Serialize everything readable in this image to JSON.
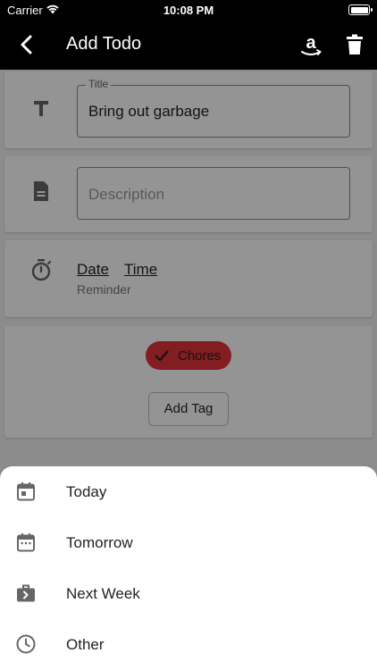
{
  "status_bar": {
    "carrier": "Carrier",
    "time": "10:08 PM"
  },
  "app_bar": {
    "title": "Add Todo"
  },
  "form": {
    "title_field": {
      "label": "Title",
      "value": "Bring out garbage"
    },
    "description_field": {
      "placeholder": "Description"
    },
    "reminder": {
      "date_label": "Date",
      "time_label": "Time",
      "subtitle": "Reminder"
    },
    "tags": {
      "selected": [
        "Chores"
      ],
      "chip_color": "#e0333c",
      "add_tag_label": "Add Tag"
    }
  },
  "bottom_sheet": {
    "items": [
      {
        "label": "Today",
        "icon": "calendar-today-icon"
      },
      {
        "label": "Tomorrow",
        "icon": "calendar-icon"
      },
      {
        "label": "Next Week",
        "icon": "next-week-icon"
      },
      {
        "label": "Other",
        "icon": "clock-icon"
      }
    ]
  }
}
